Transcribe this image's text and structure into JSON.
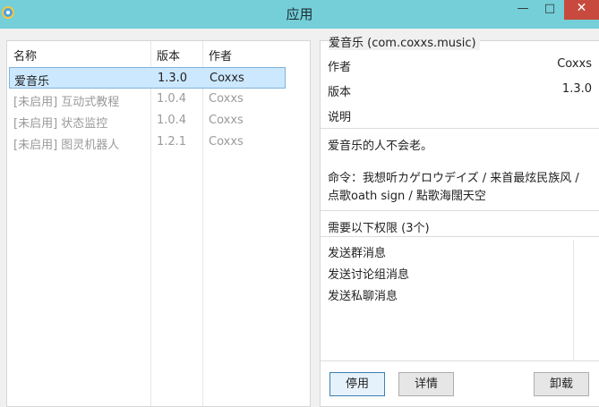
{
  "window": {
    "title": "应用",
    "minimize_glyph": "—",
    "maximize_glyph": "□",
    "close_glyph": "✕"
  },
  "list": {
    "headers": {
      "name": "名称",
      "version": "版本",
      "author": "作者"
    },
    "rows": [
      {
        "name": "爱音乐",
        "version": "1.3.0",
        "author": "Coxxs",
        "selected": true,
        "disabled": false
      },
      {
        "name": "[未启用] 互动式教程",
        "version": "1.0.4",
        "author": "Coxxs",
        "selected": false,
        "disabled": true
      },
      {
        "name": "[未启用] 状态监控",
        "version": "1.0.4",
        "author": "Coxxs",
        "selected": false,
        "disabled": true
      },
      {
        "name": "[未启用] 图灵机器人",
        "version": "1.2.1",
        "author": "Coxxs",
        "selected": false,
        "disabled": true
      }
    ]
  },
  "detail": {
    "title": "爱音乐 (com.coxxs.music)",
    "author_label": "作者",
    "author_value": "Coxxs",
    "version_label": "版本",
    "version_value": "1.3.0",
    "description_label": "说明",
    "description": "爱音乐的人不会老。",
    "commands": "命令：我想听カゲロウデイズ / 来首最炫民族风 / 点歌oath sign / 點歌海闊天空",
    "permissions_header": "需要以下权限 (3个)",
    "permissions": [
      "发送群消息",
      "发送讨论组消息",
      "发送私聊消息"
    ]
  },
  "buttons": {
    "disable": "停用",
    "details": "详情",
    "uninstall": "卸载"
  }
}
